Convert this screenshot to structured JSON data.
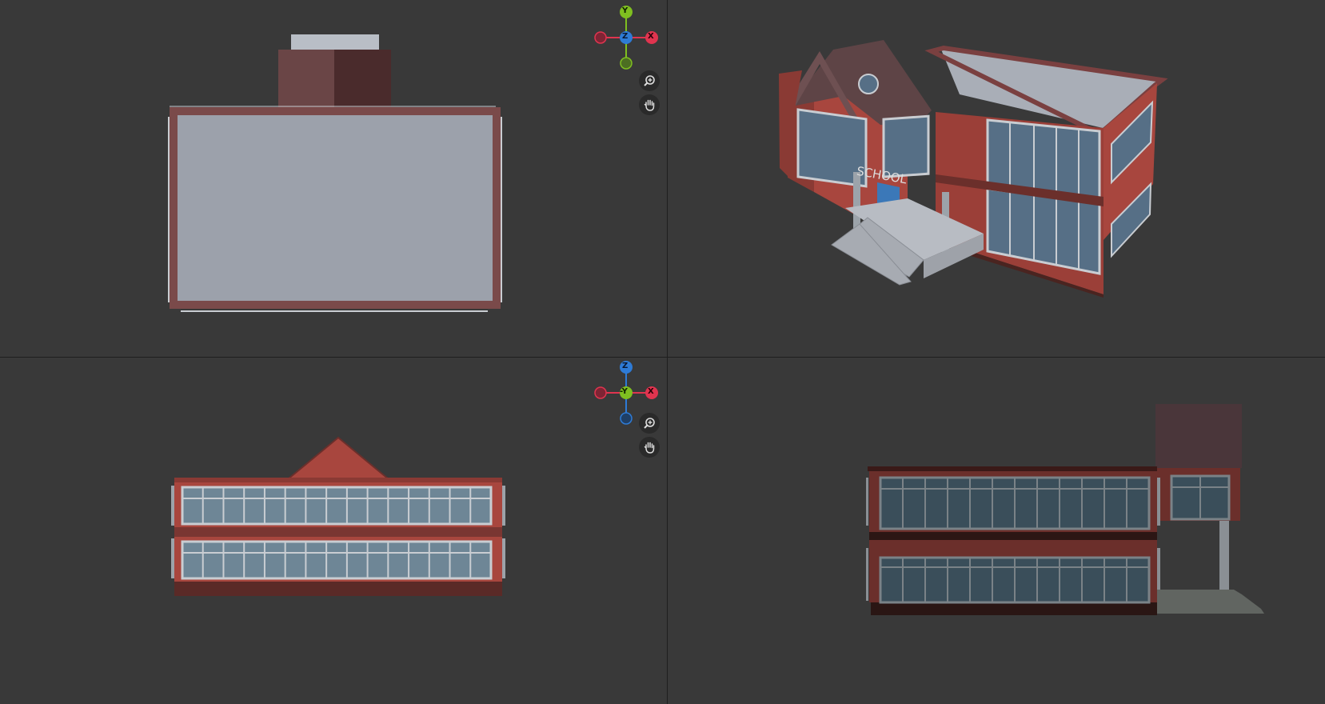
{
  "viewports": [
    {
      "id": "top",
      "gizmo": {
        "up_label": "Y",
        "center_label": "Z",
        "right_label": "X"
      }
    },
    {
      "id": "perspective",
      "sign_text": "SCHOOL"
    },
    {
      "id": "front",
      "gizmo": {
        "up_label": "Z",
        "center_label": "-Y",
        "right_label": "X"
      }
    },
    {
      "id": "side"
    }
  ],
  "icons": {
    "zoom": "zoom-in-icon",
    "pan": "hand-pan-icon"
  },
  "colors": {
    "bg": "#393939",
    "divider": "#1f1f1f",
    "axis_x": "#e0344f",
    "axis_y": "#7fbf20",
    "axis_z": "#2e7bd6",
    "brick": "#a8463e",
    "brick_dark": "#6b2f2b",
    "roof": "#5e4446",
    "roof_flat": "#9aa0aa",
    "glass": "#566f86",
    "frame": "#c9cdd2"
  }
}
